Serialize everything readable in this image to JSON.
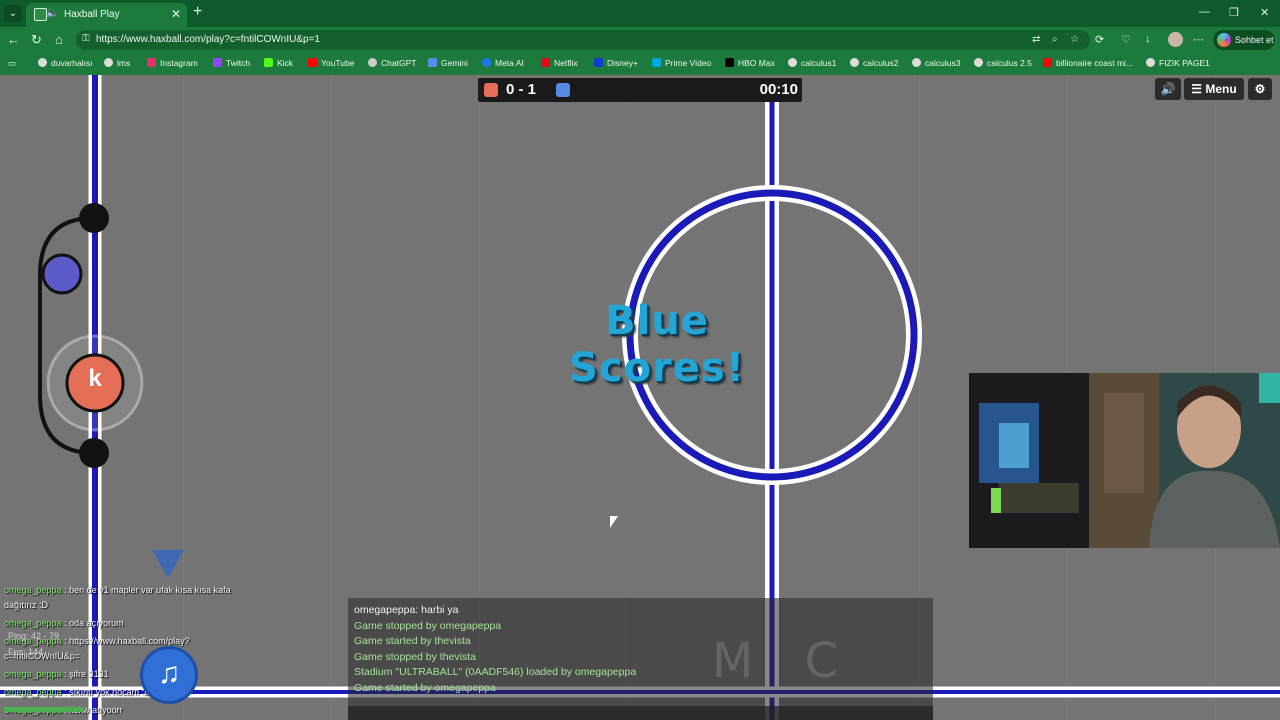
{
  "browser": {
    "tab_title": "Haxball Play",
    "url": "https://www.haxball.com/play?c=fntilCOWnIU&p=1",
    "copilot_label": "Sohbet et",
    "bookmarks": [
      "duvarhalısı",
      "lms",
      "Instagram",
      "Twitch",
      "Kick",
      "YouTube",
      "ChatGPT",
      "Gemini",
      "Meta AI",
      "Netflix",
      "Disney+",
      "Prime Video",
      "HBO Max",
      "calculus1",
      "calculus2",
      "calculus3",
      "calculus 2.5",
      "billionaire coast mi...",
      "FIZIK PAGE1"
    ]
  },
  "game": {
    "score": "0 - 1",
    "time": "00:10",
    "menu_label": "Menu",
    "goal_line1": "Blue",
    "goal_line2": "Scores!",
    "player_letter": "k",
    "watermark": "M  C"
  },
  "chat": {
    "messages": [
      {
        "text": "omegapeppa: harbi ya",
        "kind": "plain"
      },
      {
        "text": "Game stopped by omegapeppa",
        "kind": "sys"
      },
      {
        "text": "Game started by thevista",
        "kind": "sys"
      },
      {
        "text": "Game stopped by thevista",
        "kind": "sys"
      },
      {
        "text": "Stadium \"ULTRABALL\" (0AADF546) loaded by omegapeppa",
        "kind": "sys"
      },
      {
        "text": "Game started by omegapeppa",
        "kind": "sys"
      }
    ]
  },
  "stream_chat": {
    "lines": [
      {
        "name": "omega_peppa",
        "text": " : ben de v1 mapler var ufak kısa kısa kafa"
      },
      {
        "name": "",
        "text": "dağıtırız :D"
      },
      {
        "name": "omega_peppa",
        "text": " : oda açıyorum"
      },
      {
        "name": "omega_peppa",
        "text": " : https://www.haxball.com/play?"
      },
      {
        "name": "",
        "text": "c=fntilCOWnIU&p="
      },
      {
        "name": "omega_peppa",
        "text": " : şifre 3131"
      },
      {
        "name": "omega_peppa",
        "text": " : sıkıntı yok hocam :D"
      },
      {
        "name": "omega_peppa",
        "text": " : kekw atıyoorr"
      }
    ],
    "ping": "Ping: 42 - 79",
    "fps": "Fps: 144"
  },
  "colors": {
    "red_team": "#e56e56",
    "blue_team": "#5689e5",
    "field_line_blue": "#1a1ab8",
    "goal_text": "#23a6d5"
  }
}
